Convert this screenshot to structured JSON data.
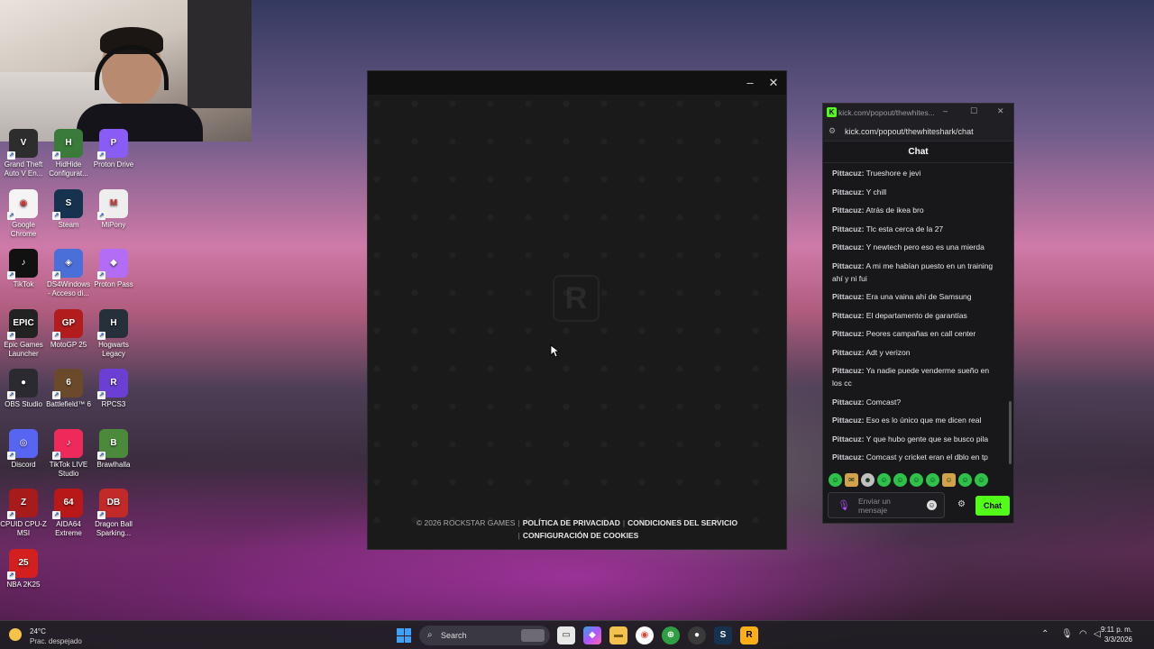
{
  "webcam": {},
  "desktop_icons": [
    {
      "name": "grand-theft-auto-v-icon",
      "label": "Grand Theft Auto V En...",
      "color": "#2d2d2d",
      "glyph": "V"
    },
    {
      "name": "hidhide-icon",
      "label": "HidHide Configurat...",
      "color": "#3a7a3a",
      "glyph": "H"
    },
    {
      "name": "proton-drive-icon",
      "label": "Proton Drive",
      "color": "#8a5cf6",
      "glyph": "P"
    },
    {
      "name": "google-chrome-icon",
      "label": "Google Chrome",
      "color": "#f4f4f4",
      "glyph": "◉"
    },
    {
      "name": "steam-icon",
      "label": "Steam",
      "color": "#17324f",
      "glyph": "S"
    },
    {
      "name": "mipony-icon",
      "label": "MiPony",
      "color": "#eeeeee",
      "glyph": "M"
    },
    {
      "name": "tiktok-icon",
      "label": "TikTok",
      "color": "#111111",
      "glyph": "♪"
    },
    {
      "name": "ds4windows-icon",
      "label": "DS4Windows - Acceso di...",
      "color": "#4a6fd8",
      "glyph": "◈"
    },
    {
      "name": "proton-pass-icon",
      "label": "Proton Pass",
      "color": "#b26cf6",
      "glyph": "◆"
    },
    {
      "name": "epic-games-icon",
      "label": "Epic Games Launcher",
      "color": "#222222",
      "glyph": "EPIC"
    },
    {
      "name": "motogp-icon",
      "label": "MotoGP 25",
      "color": "#b21c1c",
      "glyph": "GP"
    },
    {
      "name": "hogwarts-legacy-icon",
      "label": "Hogwarts Legacy",
      "color": "#26303a",
      "glyph": "H"
    },
    {
      "name": "obs-studio-icon",
      "label": "OBS Studio",
      "color": "#2a2a30",
      "glyph": "●"
    },
    {
      "name": "battlefield-icon",
      "label": "Battlefield™ 6",
      "color": "#6a4a2a",
      "glyph": "6"
    },
    {
      "name": "rpcs3-icon",
      "label": "RPCS3",
      "color": "#6b3fd4",
      "glyph": "R"
    },
    {
      "name": "discord-icon",
      "label": "Discord",
      "color": "#5865f2",
      "glyph": "◎"
    },
    {
      "name": "tiktok-live-studio-icon",
      "label": "TikTok LIVE Studio",
      "color": "#ee2a5a",
      "glyph": "♪"
    },
    {
      "name": "brawlhalla-icon",
      "label": "Brawlhalla",
      "color": "#4b8a3a",
      "glyph": "B"
    },
    {
      "name": "cpuid-icon",
      "label": "CPUID CPU-Z MSI",
      "color": "#a81b1b",
      "glyph": "Z"
    },
    {
      "name": "aida64-icon",
      "label": "AIDA64 Extreme",
      "color": "#b81818",
      "glyph": "64"
    },
    {
      "name": "dragon-ball-icon",
      "label": "Dragon Ball Sparking...",
      "color": "#c22a2a",
      "glyph": "DB"
    },
    {
      "name": "nba-2k25-icon",
      "label": "NBA 2K25",
      "color": "#d41f1f",
      "glyph": "25"
    }
  ],
  "rockstar": {
    "logo": "R",
    "footer": {
      "copyright": "© 2026 ROCKSTAR GAMES",
      "privacy": "POLÍTICA DE PRIVACIDAD",
      "terms": "CONDICIONES DEL SERVICIO",
      "cookies": "CONFIGURACIÓN DE COOKIES"
    }
  },
  "kick": {
    "tab_title": "kick.com/popout/thewhites...",
    "url": "kick.com/popout/thewhiteshark/chat",
    "header": "Chat",
    "accent": "#53fc18",
    "messages": [
      {
        "user": "Pittacuz:",
        "text": "Trueshore e jevi"
      },
      {
        "user": "Pittacuz:",
        "text": "Y chill"
      },
      {
        "user": "Pittacuz:",
        "text": "Atrás de ikea bro"
      },
      {
        "user": "Pittacuz:",
        "text": "Tlc esta cerca de la 27"
      },
      {
        "user": "Pittacuz:",
        "text": "Y newtech pero eso es una mierda"
      },
      {
        "user": "Pittacuz:",
        "text": "A mi me habían puesto en un training ahí y ni fui"
      },
      {
        "user": "Pittacuz:",
        "text": "Era una vaina ahí de Samsung"
      },
      {
        "user": "Pittacuz:",
        "text": "El departamento de garantías"
      },
      {
        "user": "Pittacuz:",
        "text": "Peores campañas en call center"
      },
      {
        "user": "Pittacuz:",
        "text": "Adt y verizon"
      },
      {
        "user": "Pittacuz:",
        "text": "Ya nadie puede venderme sueño en los cc"
      },
      {
        "user": "Pittacuz:",
        "text": "Comcast?"
      },
      {
        "user": "Pittacuz:",
        "text": "Eso es lo único que me dicen real"
      },
      {
        "user": "Pittacuz:",
        "text": "Y que hubo gente que se busco pila"
      },
      {
        "user": "Pittacuz:",
        "text": "Comcast y cricket eran el dblo en tp"
      }
    ],
    "input_placeholder": "Enviar un mensaje",
    "send_label": "Chat"
  },
  "taskbar": {
    "temp": "24°C",
    "weather": "Prac. despejado",
    "search_label": "Search",
    "time": "9:11 p. m.",
    "date": "3/3/2026"
  }
}
